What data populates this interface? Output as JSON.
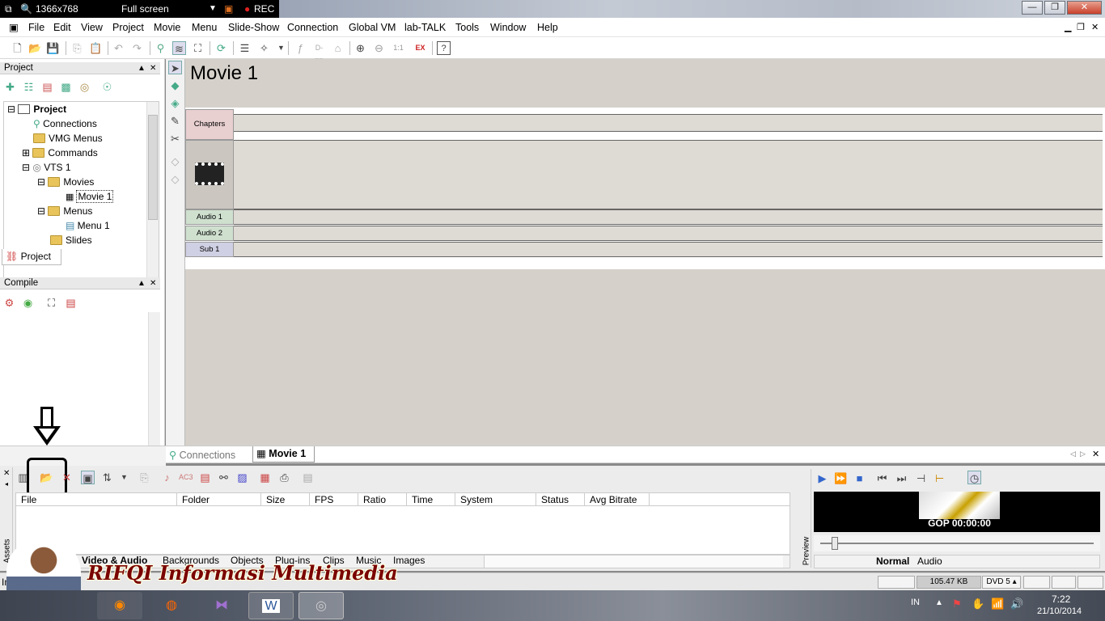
{
  "recorder": {
    "resolution": "1366x768",
    "mode": "Full screen",
    "rec": "REC"
  },
  "window_controls": {
    "minimize": "—",
    "maximize": "❐",
    "close": "✕"
  },
  "menu": [
    "File",
    "Edit",
    "View",
    "Project",
    "Movie",
    "Menu",
    "Slide-Show",
    "Connection",
    "Global VM",
    "lab-TALK",
    "Tools",
    "Window",
    "Help"
  ],
  "project_panel": {
    "title": "Project",
    "tab": "Project",
    "tree": [
      "Project",
      "Connections",
      "VMG Menus",
      "Commands",
      "VTS 1",
      "Movies",
      "Movie 1",
      "Menus",
      "Menu 1",
      "Slides"
    ]
  },
  "compile_panel": {
    "title": "Compile"
  },
  "timeline": {
    "title": "Movie 1",
    "tracks": {
      "chapters": "Chapters",
      "audio1": "Audio 1",
      "audio2": "Audio 2",
      "sub1": "Sub 1"
    }
  },
  "doc_tabs": [
    "Connections",
    "Movie 1"
  ],
  "assets": {
    "side_label": "Assets",
    "columns": [
      "File",
      "Folder",
      "Size",
      "FPS",
      "Ratio",
      "Time",
      "System",
      "Status",
      "Avg Bitrate"
    ],
    "tabs": [
      "Video & Audio",
      "Backgrounds",
      "Objects",
      "Plug-ins",
      "Clips",
      "Music",
      "Images"
    ]
  },
  "preview": {
    "side_label": "Preview",
    "gop": "GOP 00:00:00",
    "tabs": [
      "Normal",
      "Audio"
    ]
  },
  "status": {
    "size": "105.47 KB",
    "disc": "DVD 5",
    "left_text": "Im"
  },
  "watermark": "RIFQI Informasi Multimedia",
  "clock": {
    "time": "7:22",
    "date": "21/10/2014",
    "lang": "IN"
  }
}
